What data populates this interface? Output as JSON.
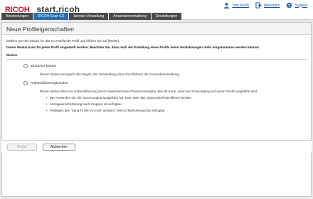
{
  "header": {
    "logo": "RICOH",
    "app_name": "start.ricoh",
    "user_links": [
      {
        "label": "Tom Ricoh",
        "icon": "user-icon"
      },
      {
        "label": "Abmelden",
        "icon": "logout-icon"
      },
      {
        "label": "Support",
        "icon": "help-icon"
      }
    ]
  },
  "tabs": [
    {
      "label": "Anwendungen",
      "active": false
    },
    {
      "label": "RICOH Scan CX",
      "active": true
    },
    {
      "label": "Service-Verwaltung",
      "active": false
    },
    {
      "label": "Anwenderverwaltung",
      "active": false
    },
    {
      "label": "Einstellungen",
      "active": false
    }
  ],
  "page": {
    "title": "Neue Profileigenschaften",
    "intro": "Wählen Sie den Modus für das zu erstellende Profil und klicken Sie auf [Weiter].",
    "warning": "Dieser Modus kann für jedes Profil eingestellt werden. Beachten Sie, dass nach der Erstellung eines Profils keine Veränderungen mehr vorgenommen werden können.",
    "section": "Modus",
    "option1": {
      "label": "Einfacher Modus",
      "desc": "Dieser Modus ermöglicht den Beginn der Verwendung ohne Durchführen der Anwenderverwaltung."
    },
    "option2": {
      "label": "Authentifizierungsmodus",
      "desc": "Dieser Modus dient zur Authentifizierung durch Anwendername-/Passworteingabe oder ID-Karte, wenn ein Scanvorgang auf einem Gerät ausgeführt wird.",
      "bullets": [
        "Der Anwender, der den Scanvorgang ausgeführt hat, kann über das Jobprotokoll identifiziert werden.",
        "Anzeigeeinschränkung nach Gruppen ist verfügbar.",
        "Festlegen des \"Send To Me (An mich senden)\" beim E-Mail-Versand ist verfügbar."
      ]
    }
  },
  "buttons": {
    "next": "Weiter",
    "cancel": "Abbrechen"
  },
  "colors": {
    "brand_red": "#c8102e",
    "tab_active": "#2b6cb3",
    "tab_inactive": "#4a4a4a",
    "link": "#1a4fa3"
  }
}
